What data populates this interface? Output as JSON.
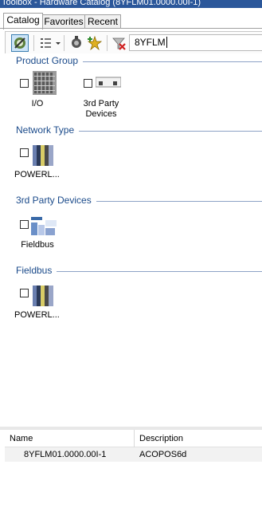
{
  "window": {
    "title": "Toolbox - Hardware Catalog (8YFLM01.0000.00I-1)"
  },
  "tabs": [
    {
      "label": "Catalog",
      "active": true
    },
    {
      "label": "Favorites",
      "active": false
    },
    {
      "label": "Recent",
      "active": false
    }
  ],
  "toolbar": {
    "buttons": [
      "filter-icon",
      "list-view-icon",
      "chevron-down-icon",
      "network-icon",
      "star-add-icon",
      "clear-filter-icon"
    ],
    "search_value": "8YFLM"
  },
  "groups": [
    {
      "title": "Product Group",
      "items": [
        {
          "label": "I/O",
          "icon": "io-module-icon",
          "checked": false
        },
        {
          "label": "3rd Party Devices",
          "icon": "third-party-device-icon",
          "checked": false
        }
      ]
    },
    {
      "title": "Network Type",
      "items": [
        {
          "label": "POWERL...",
          "icon": "powerlink-icon",
          "checked": false
        }
      ]
    },
    {
      "title": "3rd Party Devices",
      "items": [
        {
          "label": "Fieldbus",
          "icon": "fieldbus-icon",
          "checked": false
        }
      ]
    },
    {
      "title": "Fieldbus",
      "items": [
        {
          "label": "POWERL...",
          "icon": "powerlink-icon",
          "checked": false
        }
      ]
    }
  ],
  "results": {
    "columns": [
      "Name",
      "Description"
    ],
    "rows": [
      {
        "name": "8YFLM01.0000.00I-1",
        "description": "ACOPOS6d"
      }
    ]
  },
  "colors": {
    "group_header": "#1a4a8a",
    "accent": "#3c7fb1",
    "title_bar": "#2b579a"
  }
}
